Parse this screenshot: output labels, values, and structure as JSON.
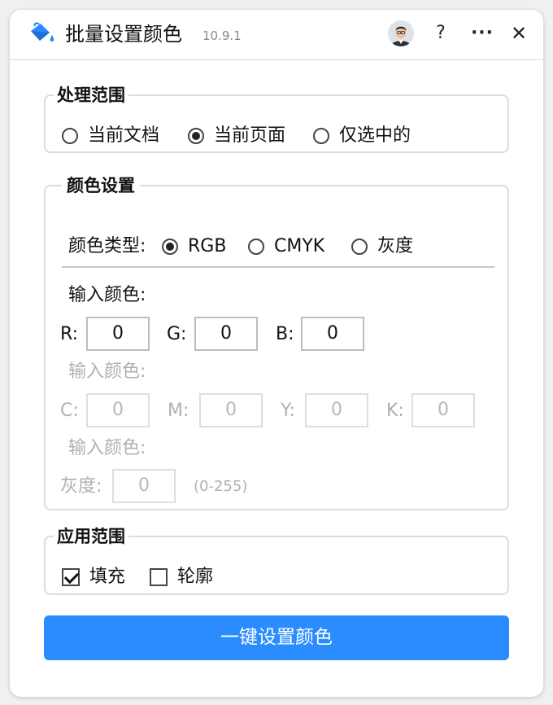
{
  "app": {
    "title": "批量设置颜色",
    "version": "10.9.1",
    "help_label": "?",
    "more_label": "···",
    "close_label": "✕",
    "icon": "paint-bucket-icon"
  },
  "processing_range": {
    "legend": "处理范围",
    "options": [
      {
        "label": "当前文档",
        "selected": false
      },
      {
        "label": "当前页面",
        "selected": true
      },
      {
        "label": "仅选中的",
        "selected": false
      }
    ]
  },
  "color_settings": {
    "legend": "颜色设置",
    "type_label": "颜色类型:",
    "types": [
      {
        "label": "RGB",
        "selected": true
      },
      {
        "label": "CMYK",
        "selected": false
      },
      {
        "label": "灰度",
        "selected": false
      }
    ],
    "rgb": {
      "input_label": "输入颜色:",
      "r_label": "R:",
      "r_value": "0",
      "g_label": "G:",
      "g_value": "0",
      "b_label": "B:",
      "b_value": "0"
    },
    "cmyk": {
      "input_label": "输入颜色:",
      "c_label": "C:",
      "c_value": "0",
      "m_label": "M:",
      "m_value": "0",
      "y_label": "Y:",
      "y_value": "0",
      "k_label": "K:",
      "k_value": "0"
    },
    "gray": {
      "input_label": "输入颜色:",
      "gray_label": "灰度:",
      "gray_value": "0",
      "range_hint": "(0-255)"
    }
  },
  "apply_range": {
    "legend": "应用范围",
    "options": [
      {
        "label": "填充",
        "checked": true
      },
      {
        "label": "轮廓",
        "checked": false
      }
    ]
  },
  "action": {
    "label": "一键设置颜色",
    "color": "#2a8cff"
  }
}
